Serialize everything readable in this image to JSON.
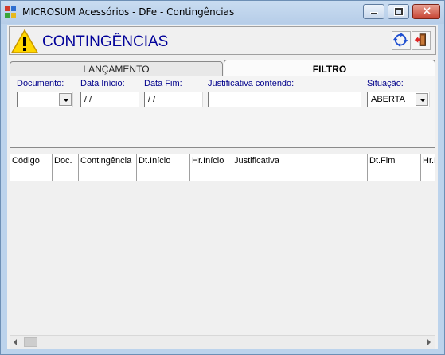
{
  "window": {
    "title": "MICROSUM Acessórios - DFe - Contingências",
    "close_glyph": "✕"
  },
  "header": {
    "title": "CONTINGÊNCIAS",
    "icon": "warning-icon",
    "buttons": [
      "refresh-icon",
      "exit-door-icon"
    ]
  },
  "tabs": [
    {
      "label": "LANÇAMENTO",
      "active": false
    },
    {
      "label": "FILTRO",
      "active": true
    }
  ],
  "filter": {
    "documento_label": "Documento:",
    "documento_value": "",
    "data_inicio_label": "Data Início:",
    "data_inicio_value": " /  /",
    "data_fim_label": "Data Fim:",
    "data_fim_value": " /  /",
    "justificativa_label": "Justificativa contendo:",
    "justificativa_value": "",
    "situacao_label": "Situação:",
    "situacao_value": "ABERTA"
  },
  "grid": {
    "columns": [
      "Código",
      "Doc.",
      "Contingência",
      "Dt.Início",
      "Hr.Início",
      "Justificativa",
      "Dt.Fim",
      "Hr.Fim"
    ]
  },
  "colors": {
    "label_blue": "#00008b",
    "title_blue": "#000099",
    "warning_yellow": "#ffd700"
  }
}
